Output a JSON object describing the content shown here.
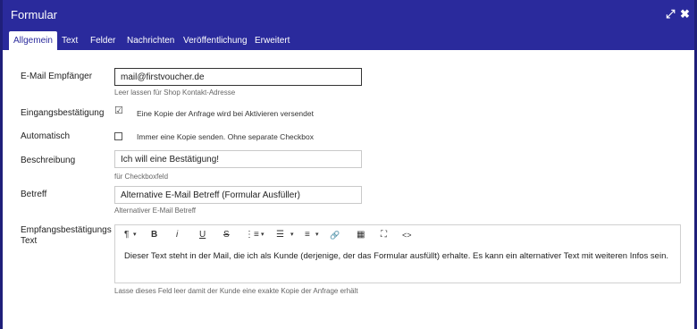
{
  "dialog": {
    "title": "Formular",
    "controls": {
      "expand": "⤢",
      "close": "✖"
    }
  },
  "tabs": [
    {
      "label": "Allgemein",
      "active": true
    },
    {
      "label": "Text"
    },
    {
      "label": "Felder"
    },
    {
      "label": "Nachrichten"
    },
    {
      "label": "Veröffentlichung"
    },
    {
      "label": "Erweitert"
    }
  ],
  "form": {
    "email": {
      "label": "E-Mail Empfänger",
      "value": "mail@firstvoucher.de",
      "hint": "Leer lassen für Shop Kontakt-Adresse"
    },
    "confirmation": {
      "label": "Eingangsbestätigung",
      "checked": true,
      "text": "Eine Kopie der Anfrage wird bei Aktivieren versendet"
    },
    "automatic": {
      "label": "Automatisch",
      "checked": false,
      "text": "Immer eine Kopie senden. Ohne separate Checkbox"
    },
    "description": {
      "label": "Beschreibung",
      "value": "Ich will eine Bestätigung!",
      "hint": "für Checkboxfeld"
    },
    "subject": {
      "label": "Betreff",
      "value": "Alternative E-Mail Betreff (Formular Ausfüller)",
      "hint": "Alternativer E-Mail Betreff"
    },
    "confirmation_text": {
      "label": "Empfangsbestätigungs Text",
      "content": "Dieser Text steht in der Mail, die ich als Kunde (derjenige, der das Formular ausfüllt) erhalte. Es kann ein alternativer Text mit weiteren Infos sein.",
      "hint": "Lasse dieses Feld leer damit der Kunde eine exakte Kopie der Anfrage erhält"
    }
  },
  "toolbar": {
    "paragraph": "¶",
    "bold": "B",
    "italic": "i",
    "underline": "U",
    "strike": "S",
    "ordered_list": "⋮≡",
    "unordered_list": "☰",
    "align": "≡",
    "link": "🔗",
    "table": "▦",
    "fullscreen": "⛶",
    "code": "<>",
    "caret": "▾"
  }
}
